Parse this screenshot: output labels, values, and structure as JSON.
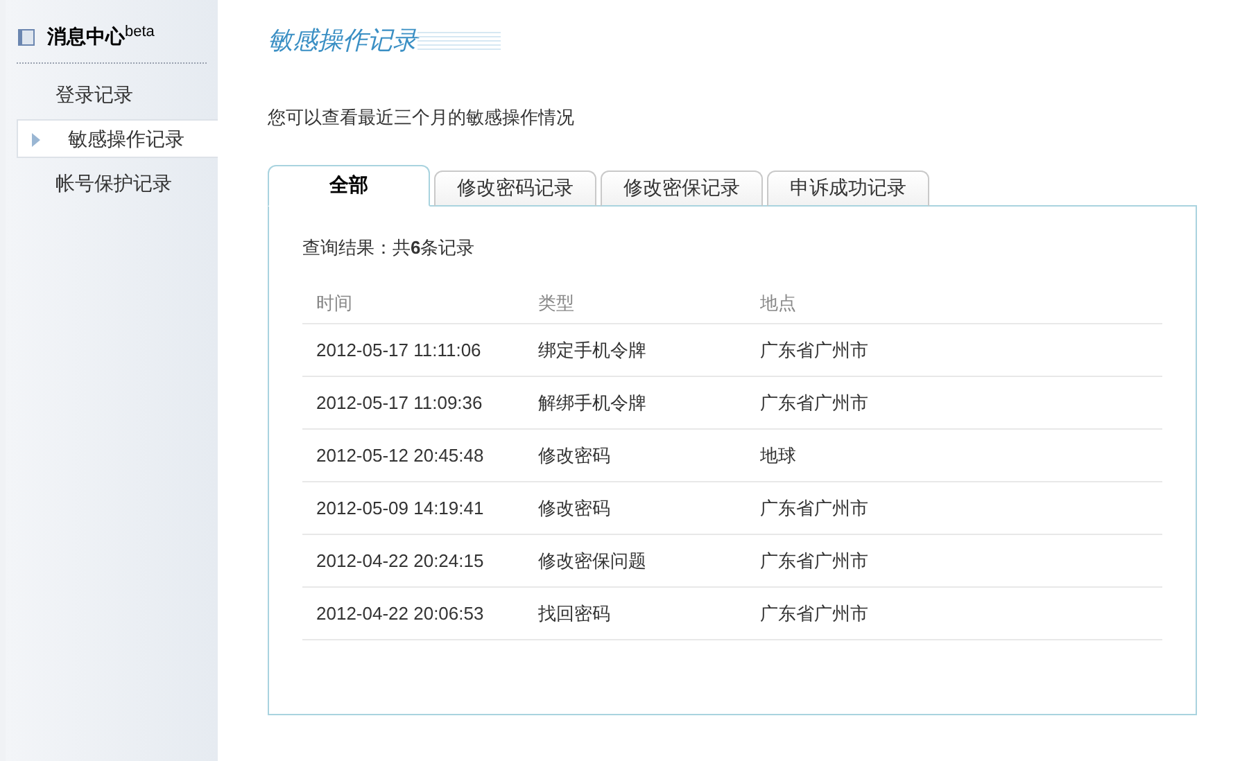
{
  "sidebar": {
    "title": "消息中心$^{beta}$",
    "items": [
      {
        "label": "登录记录",
        "selected": false
      },
      {
        "label": "敏感操作记录",
        "selected": true
      },
      {
        "label": "帐号保护记录",
        "selected": false
      }
    ]
  },
  "page_title": "敏感操作记录",
  "description": "您可以查看最近三个月的敏感操作情况",
  "tabs": [
    {
      "label": "全部",
      "selected": true
    },
    {
      "label": "修改密码记录",
      "selected": false
    },
    {
      "label": "修改密保记录",
      "selected": false
    },
    {
      "label": "申诉成功记录",
      "selected": false
    }
  ],
  "result_summary": "查询结果：共**6**条记录",
  "table": {
    "columns": [
      "时间",
      "类型",
      "地点"
    ],
    "rows": [
      [
        "2012-05-17 11:11:06",
        "绑定手机令牌",
        "广东省广州市"
      ],
      [
        "2012-05-17 11:09:36",
        "解绑手机令牌",
        "广东省广州市"
      ],
      [
        "2012-05-12 20:45:48",
        "修改密码",
        "地球"
      ],
      [
        "2012-05-09 14:19:41",
        "修改密码",
        "广东省广州市"
      ],
      [
        "2012-04-22 20:24:15",
        "修改密保问题",
        "广东省广州市"
      ],
      [
        "2012-04-22 20:06:53",
        "找回密码",
        "广东省广州市"
      ]
    ]
  }
}
